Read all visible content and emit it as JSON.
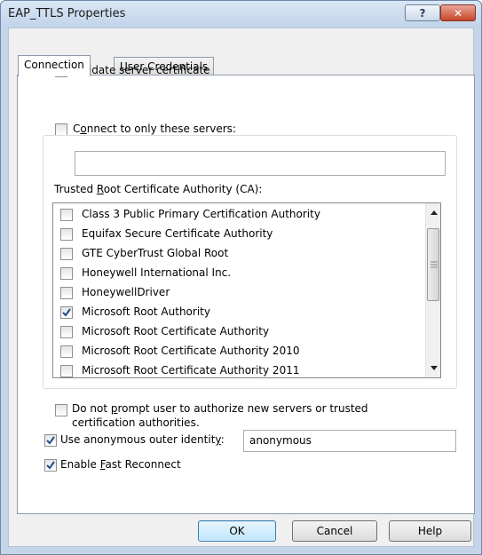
{
  "window": {
    "title": "EAP_TTLS Properties",
    "help_glyph": "?",
    "close_glyph": "✕"
  },
  "tabs": [
    {
      "label": "Connection",
      "active": true
    },
    {
      "label": "User Credentials",
      "active": false
    }
  ],
  "connection": {
    "validate_cert": {
      "label_pre": "",
      "label_accel": "V",
      "label_post": "alidate server certificate",
      "checked": true
    },
    "connect_only": {
      "label_pre": "C",
      "label_accel": "o",
      "label_post": "nnect to only these servers:",
      "checked": false,
      "value": ""
    },
    "trusted_root": {
      "label_pre": "Trusted ",
      "label_accel": "R",
      "label_post": "oot Certificate Authority (CA):"
    },
    "ca_list": [
      {
        "label": "Class 3 Public Primary Certification Authority",
        "checked": false
      },
      {
        "label": "Equifax Secure Certificate Authority",
        "checked": false
      },
      {
        "label": "GTE CyberTrust Global Root",
        "checked": false
      },
      {
        "label": "Honeywell International Inc.",
        "checked": false
      },
      {
        "label": "HoneywellDriver",
        "checked": false
      },
      {
        "label": "Microsoft Root Authority",
        "checked": true
      },
      {
        "label": "Microsoft Root Certificate Authority",
        "checked": false
      },
      {
        "label": "Microsoft Root Certificate Authority 2010",
        "checked": false
      },
      {
        "label": "Microsoft Root Certificate Authority 2011",
        "checked": false
      }
    ],
    "no_prompt": {
      "line1_pre": "Do not ",
      "line1_accel": "p",
      "line1_post": "rompt user to authorize new servers or trusted",
      "line2": "certification authorities.",
      "checked": false
    },
    "anon_identity": {
      "label_pre": "Use anonymous outer identit",
      "label_accel": "y",
      "label_post": ":",
      "checked": true,
      "value": "anonymous"
    },
    "fast_reconnect": {
      "label_pre": "Enable ",
      "label_accel": "F",
      "label_post": "ast Reconnect",
      "checked": true
    }
  },
  "buttons": {
    "ok": "OK",
    "cancel": "Cancel",
    "help": "Help"
  },
  "colors": {
    "title_bar": "#c2d4ea",
    "close_button": "#c6442a",
    "checkmark": "#1e4f8c"
  }
}
